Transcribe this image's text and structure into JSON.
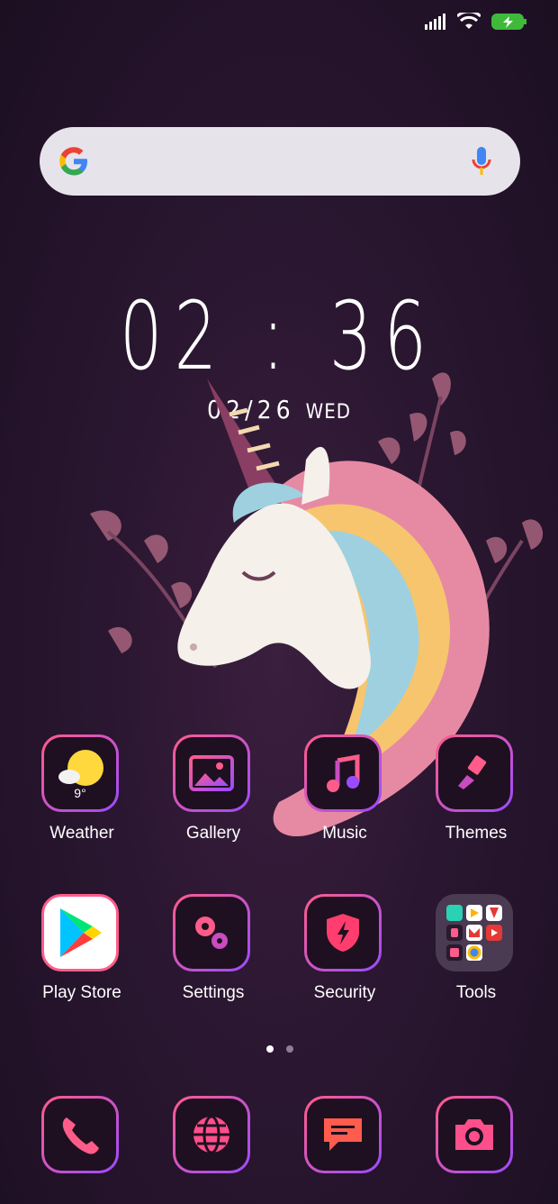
{
  "clock": {
    "time": "02 : 36",
    "date": "02/26",
    "weekday": "WED"
  },
  "weather": {
    "temp": "9°"
  },
  "apps_row1": [
    {
      "label": "Weather",
      "icon": "sun-cloud-icon"
    },
    {
      "label": "Gallery",
      "icon": "image-icon"
    },
    {
      "label": "Music",
      "icon": "music-note-icon"
    },
    {
      "label": "Themes",
      "icon": "brush-icon"
    }
  ],
  "apps_row2": [
    {
      "label": "Play Store",
      "icon": "play-store-icon"
    },
    {
      "label": "Settings",
      "icon": "gears-icon"
    },
    {
      "label": "Security",
      "icon": "shield-bolt-icon"
    },
    {
      "label": "Tools",
      "icon": "folder-icon"
    }
  ],
  "dock": [
    {
      "icon": "phone-icon"
    },
    {
      "icon": "globe-icon"
    },
    {
      "icon": "chat-icon"
    },
    {
      "icon": "camera-icon"
    }
  ],
  "pages": {
    "current": 1,
    "total": 2
  },
  "colors": {
    "accent_pink": "#ff5c8a",
    "accent_purple": "#9b4bff",
    "background": "#2a1630"
  }
}
